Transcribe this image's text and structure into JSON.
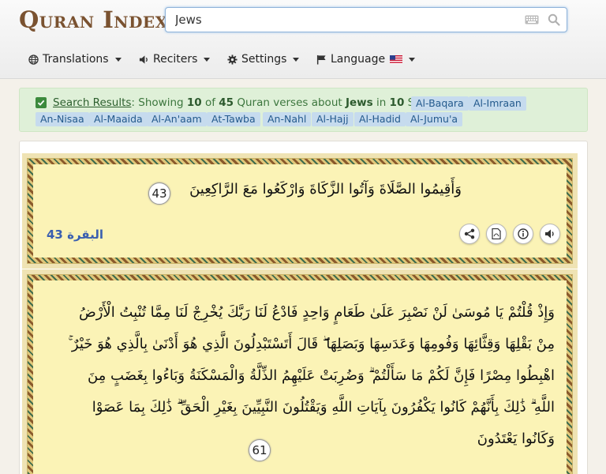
{
  "app": {
    "logo": "Quran Index"
  },
  "search": {
    "value": "Jews",
    "placeholder": ""
  },
  "nav": {
    "translations": "Translations",
    "reciters": "Reciters",
    "settings": "Settings",
    "language": "Language"
  },
  "results": {
    "link": "Search Results",
    "t1": ": Showing ",
    "shown": "10",
    "t2": " of ",
    "total": "45",
    "t3": " Quran verses about ",
    "query": "Jews",
    "t4": " in ",
    "surah_count": "10",
    "t5": " Surahs",
    "tags": [
      "Al-Baqara",
      "Al-Imraan",
      "An-Nisaa",
      "Al-Maaida",
      "Al-An'aam",
      "At-Tawba",
      "An-Nahl",
      "Al-Hajj",
      "Al-Hadid",
      "Al-Jumu'a"
    ]
  },
  "verses": [
    {
      "lines": [
        "وَأَقِيمُوا الصَّلَاةَ وَآتُوا الزَّكَاةَ وَارْكَعُوا مَعَ الرَّاكِعِينَ"
      ],
      "number": "43",
      "reference": "البقرة 43"
    },
    {
      "lines": [
        "وَإِذْ قُلْتُمْ يَا مُوسَىٰ لَنْ نَصْبِرَ عَلَىٰ طَعَامٍ وَاحِدٍ فَادْعُ لَنَا رَبَّكَ يُخْرِجْ لَنَا مِمَّا تُنْبِتُ الْأَرْضُ",
        "مِنْ بَقْلِهَا وَقِثَّائِهَا وَفُومِهَا وَعَدَسِهَا وَبَصَلِهَا ۖ قَالَ أَتَسْتَبْدِلُونَ الَّذِي هُوَ أَدْنَىٰ بِالَّذِي هُوَ خَيْرٌ ۚ",
        "اهْبِطُوا مِصْرًا فَإِنَّ لَكُمْ مَا سَأَلْتُمْ ۗ وَضُرِبَتْ عَلَيْهِمُ الذِّلَّةُ وَالْمَسْكَنَةُ وَبَاءُوا بِغَضَبٍ مِنَ",
        "اللَّهِ ۗ ذَٰلِكَ بِأَنَّهُمْ كَانُوا يَكْفُرُونَ بِآيَاتِ اللَّهِ وَيَقْتُلُونَ النَّبِيِّينَ بِغَيْرِ الْحَقِّ ۗ ذَٰلِكَ بِمَا عَصَوْا",
        "وَكَانُوا يَعْتَدُونَ"
      ],
      "number": "61"
    }
  ],
  "colors": {
    "card_bg": "#fbf3b6",
    "results_bg": "#dff0d8",
    "tag_bg": "#c6dbee",
    "ref": "#3a5fb0"
  },
  "icons": [
    "globe-icon",
    "volume-icon",
    "gear-icon",
    "flag-icon",
    "us-flag-icon",
    "keyboard-icon",
    "search-icon",
    "check-icon",
    "share-icon",
    "pdf-icon",
    "info-icon",
    "audio-icon"
  ]
}
